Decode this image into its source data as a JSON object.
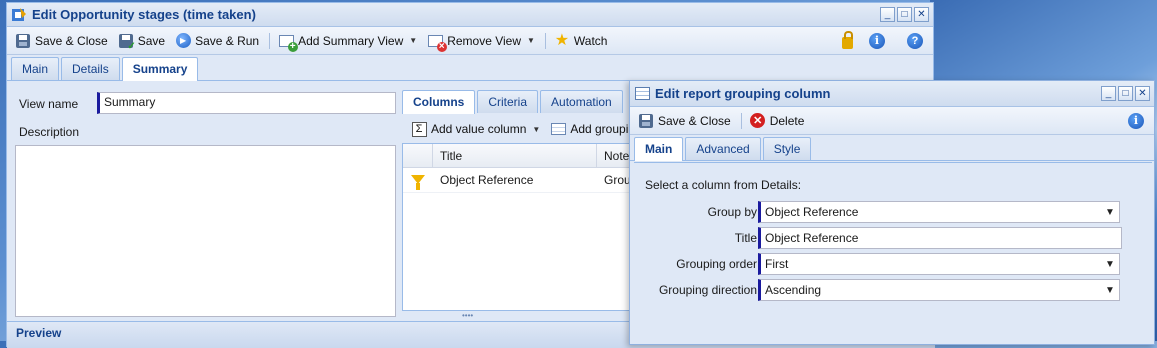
{
  "main_window": {
    "title": "Edit Opportunity stages (time taken)",
    "toolbar": {
      "save_close": "Save & Close",
      "save": "Save",
      "save_run": "Save & Run",
      "add_summary_view": "Add Summary View",
      "remove_view": "Remove View",
      "watch": "Watch"
    },
    "tabs": [
      "Main",
      "Details",
      "Summary"
    ],
    "active_tab": "Summary",
    "view_name_label": "View name",
    "view_name_value": "Summary",
    "description_label": "Description",
    "sub_tabs": [
      "Columns",
      "Criteria",
      "Automation"
    ],
    "active_sub_tab": "Columns",
    "sub_toolbar": {
      "add_value_column": "Add value column",
      "add_grouping": "Add groupi"
    },
    "grid": {
      "headers": [
        "Title",
        "Note"
      ],
      "rows": [
        {
          "title": "Object Reference",
          "note": "Grou"
        }
      ]
    },
    "preview_label": "Preview"
  },
  "dialog": {
    "title": "Edit report grouping column",
    "toolbar": {
      "save_close": "Save & Close",
      "delete": "Delete"
    },
    "tabs": [
      "Main",
      "Advanced",
      "Style"
    ],
    "active_tab": "Main",
    "instruction": "Select a column from Details:",
    "fields": {
      "group_by": {
        "label": "Group by",
        "value": "Object Reference"
      },
      "title": {
        "label": "Title",
        "value": "Object Reference"
      },
      "grouping_order": {
        "label": "Grouping order",
        "value": "First"
      },
      "grouping_direction": {
        "label": "Grouping direction",
        "value": "Ascending"
      }
    }
  },
  "colors": {
    "accent": "#15428b",
    "panel": "#dfe8f6",
    "border": "#99bbe8",
    "required_marker": "#1a1a9e"
  }
}
